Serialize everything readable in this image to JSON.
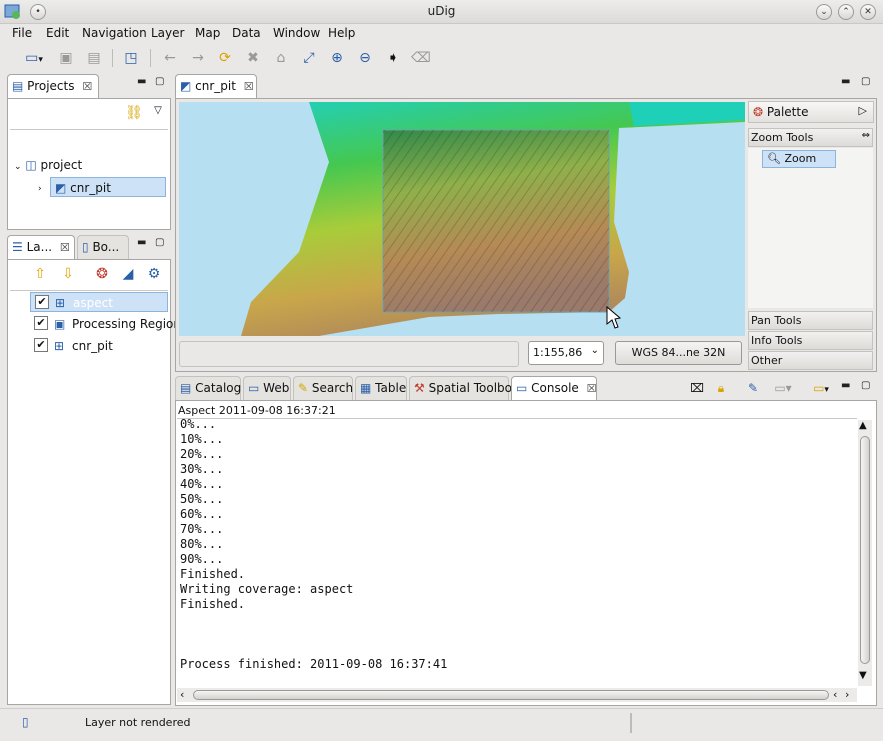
{
  "window": {
    "title": "uDig"
  },
  "menu": [
    {
      "label": "File"
    },
    {
      "label": "Edit"
    },
    {
      "label": "Navigation"
    },
    {
      "label": "Layer"
    },
    {
      "label": "Map"
    },
    {
      "label": "Data"
    },
    {
      "label": "Window"
    },
    {
      "label": "Help"
    }
  ],
  "projects_panel": {
    "tab_label": "Projects",
    "tree": {
      "project": "project",
      "map": "cnr_pit"
    }
  },
  "layers_panel": {
    "tab_layers": "La...",
    "tab_bookmarks": "Bo...",
    "layers": [
      {
        "name": "aspect",
        "checked": true,
        "selected": true
      },
      {
        "name": "Processing Region",
        "checked": true,
        "selected": false
      },
      {
        "name": "cnr_pit",
        "checked": true,
        "selected": false
      }
    ]
  },
  "map_editor": {
    "tab_label": "cnr_pit",
    "scale": "1:155,86",
    "crs": "WGS 84...ne 32N"
  },
  "palette": {
    "title": "Palette",
    "sections": [
      {
        "label": "Zoom Tools"
      },
      {
        "label": "Pan Tools"
      },
      {
        "label": "Info Tools"
      },
      {
        "label": "Other"
      }
    ],
    "zoom_tool": "Zoom"
  },
  "bottom_tabs": [
    {
      "label": "Catalog"
    },
    {
      "label": "Web"
    },
    {
      "label": "Search"
    },
    {
      "label": "Table"
    },
    {
      "label": "Spatial Toolbox"
    },
    {
      "label": "Console"
    }
  ],
  "console": {
    "header": "Aspect 2011-09-08 16:37:21",
    "lines": [
      "0%...",
      "10%...",
      "20%...",
      "30%...",
      "40%...",
      "50%...",
      "60%...",
      "70%...",
      "80%...",
      "90%...",
      "Finished.",
      "Writing coverage: aspect",
      "Finished.",
      "",
      "",
      "",
      "Process finished: 2011-09-08 16:37:41"
    ]
  },
  "status": {
    "message": "Layer not rendered"
  }
}
